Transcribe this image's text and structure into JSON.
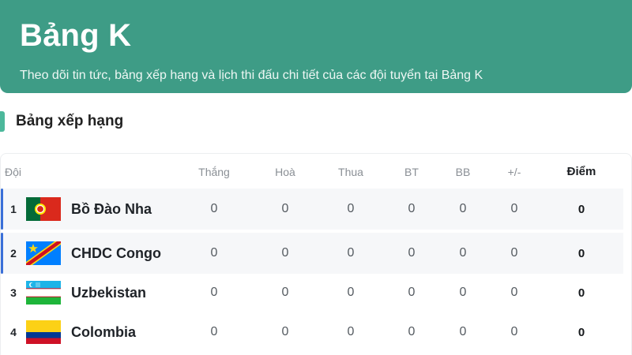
{
  "header": {
    "title": "Bảng K",
    "subtitle": "Theo dõi tin tức, bảng xếp hạng và lịch thi đấu chi tiết của các đội tuyển tại Bảng K"
  },
  "section": {
    "title": "Bảng xếp hạng"
  },
  "table": {
    "columns": {
      "team": "Đội",
      "won": "Thắng",
      "drawn": "Hoà",
      "lost": "Thua",
      "goals_for": "BT",
      "goals_against": "BB",
      "goal_diff": "+/-",
      "points": "Điểm"
    },
    "rows": [
      {
        "rank": "1",
        "team": "Bồ Đào Nha",
        "flag_icon": "portugal-flag-icon",
        "won": "0",
        "drawn": "0",
        "lost": "0",
        "goals_for": "0",
        "goals_against": "0",
        "goal_diff": "0",
        "points": "0"
      },
      {
        "rank": "2",
        "team": "CHDC Congo",
        "flag_icon": "dr-congo-flag-icon",
        "won": "0",
        "drawn": "0",
        "lost": "0",
        "goals_for": "0",
        "goals_against": "0",
        "goal_diff": "0",
        "points": "0"
      },
      {
        "rank": "3",
        "team": "Uzbekistan",
        "flag_icon": "uzbekistan-flag-icon",
        "won": "0",
        "drawn": "0",
        "lost": "0",
        "goals_for": "0",
        "goals_against": "0",
        "goal_diff": "0",
        "points": "0"
      },
      {
        "rank": "4",
        "team": "Colombia",
        "flag_icon": "colombia-flag-icon",
        "won": "0",
        "drawn": "0",
        "lost": "0",
        "goals_for": "0",
        "goals_against": "0",
        "goal_diff": "0",
        "points": "0"
      }
    ]
  },
  "colors": {
    "header_bg": "#3e9c86",
    "section_accent": "#4cb89b",
    "row_highlight_accent": "#3a6fd8"
  }
}
